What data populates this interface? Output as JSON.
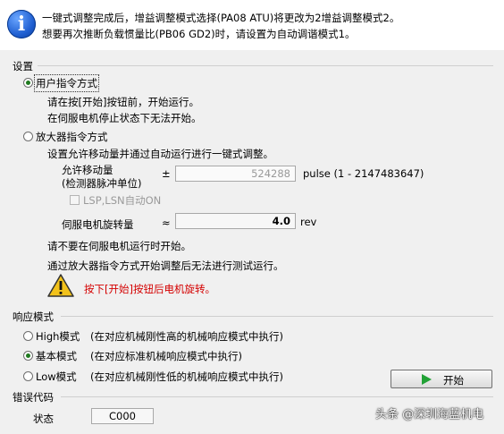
{
  "info": {
    "line1": "一键式调整完成后，增益调整模式选择(PA08 ATU)将更改为2增益调整模式2。",
    "line2": "想要再次推断负载惯量比(PB06 GD2)时，请设置为自动调谐模式1。"
  },
  "settings": {
    "title": "设置",
    "user_cmd": {
      "label": "用户指令方式",
      "desc1": "请在按[开始]按钮前，开始运行。",
      "desc2": "在伺服电机停止状态下无法开始。"
    },
    "amp_cmd": {
      "label": "放大器指令方式",
      "desc": "设置允许移动量并通过自动运行进行一键式调整。",
      "allow_label1": "允许移动量",
      "allow_label2": "(检测器脉冲单位)",
      "allow_sign": "±",
      "allow_value": "524288",
      "allow_unit": "pulse (1 - 2147483647)",
      "lsp_label": "LSP,LSN自动ON",
      "rot_label": "伺服电机旋转量",
      "rot_sign": "≈",
      "rot_value": "4.0",
      "rot_unit": "rev",
      "note1": "请不要在伺服电机运行时开始。",
      "note2": "通过放大器指令方式开始调整后无法进行测试运行。",
      "warning": "按下[开始]按钮后电机旋转。"
    }
  },
  "response": {
    "title": "响应模式",
    "high": {
      "label": "High模式",
      "desc": "(在对应机械刚性高的机械响应模式中执行)"
    },
    "basic": {
      "label": "基本模式",
      "desc": "(在对应标准机械响应模式中执行)"
    },
    "low": {
      "label": "Low模式",
      "desc": "(在对应机械刚性低的机械响应模式中执行)"
    },
    "start_label": "开始"
  },
  "error": {
    "title": "错误代码",
    "status_label": "状态",
    "status_value": "C000"
  },
  "watermark": "头条 @深圳海蓝机电",
  "colors": {
    "warning_text": "#d40000",
    "radio_dot": "#1f7a1f",
    "play": "#22a236",
    "info_icon": "#1f5fd1"
  }
}
